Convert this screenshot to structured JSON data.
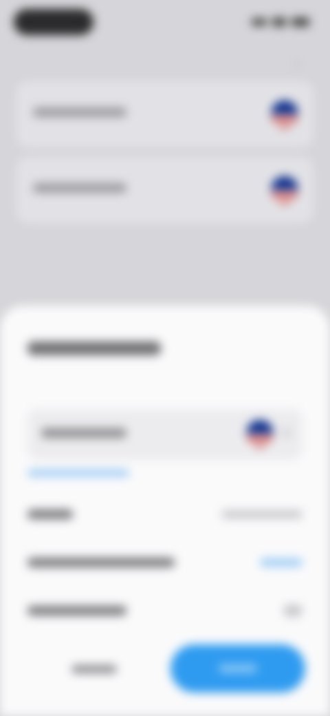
{
  "colors": {
    "primary_button": "#2f9bf0",
    "sheet_background": "#fafafb",
    "backdrop": "#d6d6da",
    "link": "#9cc9f3"
  },
  "icons": {
    "flag": "us-flag-icon",
    "chevron": "chevron-right-icon",
    "collapse": "chevron-down-icon"
  }
}
